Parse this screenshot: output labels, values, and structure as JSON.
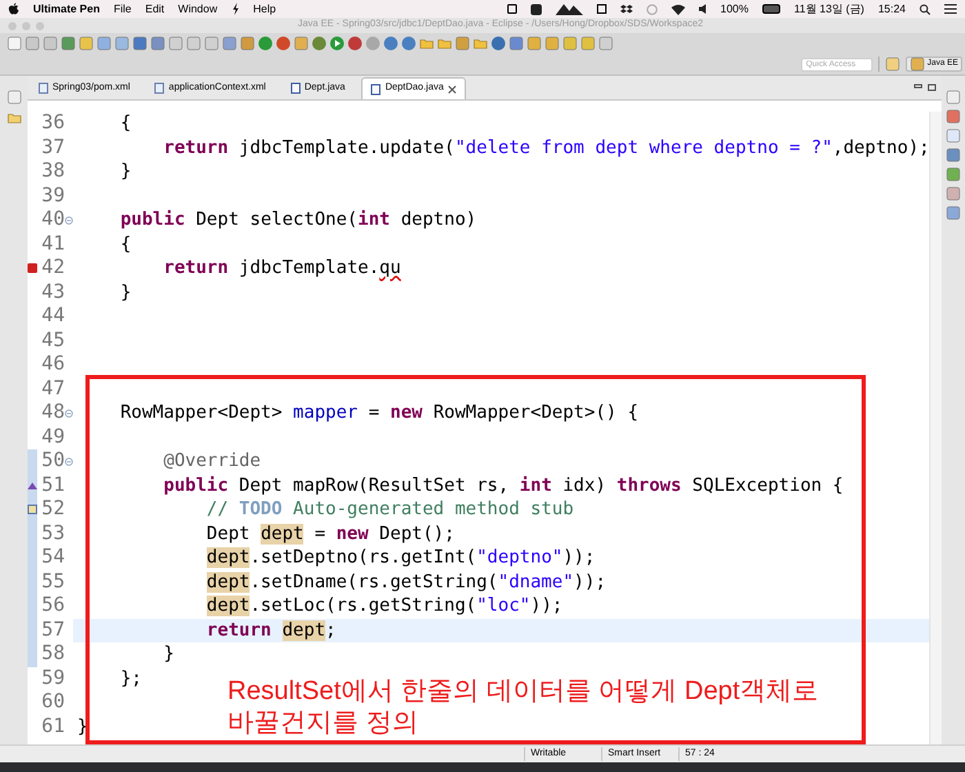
{
  "menu_bar": {
    "app_name": "Ultimate Pen",
    "items": [
      "File",
      "Edit",
      "Window",
      "Help"
    ],
    "battery": "100%",
    "date": "11월 13일 (금)",
    "time": "15:24"
  },
  "window": {
    "title": "Java EE - Spring03/src/jdbc1/DeptDao.java - Eclipse - /Users/Hong/Dropbox/SDS/Workspace2"
  },
  "toolbar": {
    "quick_access": {
      "placeholder": "Quick Access"
    },
    "perspective": "Java EE"
  },
  "tabs": [
    {
      "label": "Spring03/pom.xml",
      "kind": "xml",
      "selected": false
    },
    {
      "label": "applicationContext.xml",
      "kind": "xml",
      "selected": false
    },
    {
      "label": "Dept.java",
      "kind": "java",
      "selected": false
    },
    {
      "label": "DeptDao.java",
      "kind": "java",
      "selected": true
    }
  ],
  "editor": {
    "lines": [
      {
        "number": "36",
        "kind": "plain",
        "current": false,
        "range": false,
        "tokens": [
          {
            "kind": "plain",
            "text": "    {"
          }
        ]
      },
      {
        "number": "37",
        "kind": "plain",
        "current": false,
        "range": false,
        "tokens": [
          {
            "kind": "keyword",
            "text": "        return"
          },
          {
            "kind": "plain",
            "text": " jdbcTemplate.update("
          },
          {
            "kind": "string",
            "text": "\"delete from dept where deptno = ?\""
          },
          {
            "kind": "plain",
            "text": ",deptno);"
          }
        ]
      },
      {
        "number": "38",
        "kind": "plain",
        "current": false,
        "range": false,
        "tokens": [
          {
            "kind": "plain",
            "text": "    }"
          }
        ]
      },
      {
        "number": "39",
        "kind": "plain",
        "current": false,
        "range": false
      },
      {
        "number": "40",
        "kind": "fold",
        "current": false,
        "range": false,
        "tokens": [
          {
            "kind": "keyword",
            "text": "    public"
          },
          {
            "kind": "plain",
            "text": " Dept selectOne("
          },
          {
            "kind": "keyword",
            "text": "int"
          },
          {
            "kind": "plain",
            "text": " deptno)"
          }
        ]
      },
      {
        "number": "41",
        "kind": "plain",
        "current": false,
        "range": false,
        "tokens": [
          {
            "kind": "plain",
            "text": "    {"
          }
        ]
      },
      {
        "number": "42",
        "kind": "error",
        "current": false,
        "range": false,
        "tokens": [
          {
            "kind": "keyword",
            "text": "        return"
          },
          {
            "kind": "plain",
            "text": " jdbcTemplate."
          },
          {
            "kind": "error",
            "text": "qu"
          }
        ]
      },
      {
        "number": "43",
        "kind": "plain",
        "current": false,
        "range": false,
        "tokens": [
          {
            "kind": "plain",
            "text": "    }"
          }
        ]
      },
      {
        "number": "44",
        "kind": "plain",
        "current": false,
        "range": false
      },
      {
        "number": "45",
        "kind": "plain",
        "current": false,
        "range": false
      },
      {
        "number": "46",
        "kind": "plain",
        "current": false,
        "range": false
      },
      {
        "number": "47",
        "kind": "plain",
        "current": false,
        "range": false
      },
      {
        "number": "48",
        "kind": "fold",
        "current": false,
        "range": false,
        "tokens": [
          {
            "kind": "plain",
            "text": "    RowMapper<Dept> "
          },
          {
            "kind": "field",
            "text": "mapper"
          },
          {
            "kind": "plain",
            "text": " = "
          },
          {
            "kind": "keyword",
            "text": "new"
          },
          {
            "kind": "plain",
            "text": " RowMapper<Dept>() {"
          }
        ]
      },
      {
        "number": "49",
        "kind": "plain",
        "current": false,
        "range": false
      },
      {
        "number": "50",
        "kind": "fold",
        "current": false,
        "range": true,
        "tokens": [
          {
            "kind": "annotation",
            "text": "        @Override"
          }
        ]
      },
      {
        "number": "51",
        "kind": "override",
        "current": false,
        "range": true,
        "tokens": [
          {
            "kind": "keyword",
            "text": "        public"
          },
          {
            "kind": "plain",
            "text": " Dept mapRow(ResultSet rs, "
          },
          {
            "kind": "keyword",
            "text": "int"
          },
          {
            "kind": "plain",
            "text": " idx) "
          },
          {
            "kind": "keyword",
            "text": "throws"
          },
          {
            "kind": "plain",
            "text": " SQLException {"
          }
        ]
      },
      {
        "number": "52",
        "kind": "task",
        "current": false,
        "range": true,
        "tokens": [
          {
            "kind": "comment",
            "text": "            // "
          },
          {
            "kind": "todo",
            "text": "TODO"
          },
          {
            "kind": "comment",
            "text": " Auto-generated method stub"
          }
        ]
      },
      {
        "number": "53",
        "kind": "plain",
        "current": false,
        "range": true,
        "tokens": [
          {
            "kind": "plain",
            "text": "            Dept "
          },
          {
            "kind": "occurrence",
            "text": "dept"
          },
          {
            "kind": "plain",
            "text": " = "
          },
          {
            "kind": "keyword",
            "text": "new"
          },
          {
            "kind": "plain",
            "text": " Dept();"
          }
        ]
      },
      {
        "number": "54",
        "kind": "plain",
        "current": false,
        "range": true,
        "tokens": [
          {
            "kind": "occurrence",
            "text": "            dept"
          },
          {
            "kind": "plain",
            "text": ".setDeptno(rs.getInt("
          },
          {
            "kind": "string",
            "text": "\"deptno\""
          },
          {
            "kind": "plain",
            "text": "));"
          }
        ]
      },
      {
        "number": "55",
        "kind": "plain",
        "current": false,
        "range": true,
        "tokens": [
          {
            "kind": "occurrence",
            "text": "            dept"
          },
          {
            "kind": "plain",
            "text": ".setDname(rs.getString("
          },
          {
            "kind": "string",
            "text": "\"dname\""
          },
          {
            "kind": "plain",
            "text": "));"
          }
        ]
      },
      {
        "number": "56",
        "kind": "plain",
        "current": false,
        "range": true,
        "tokens": [
          {
            "kind": "occurrence",
            "text": "            dept"
          },
          {
            "kind": "plain",
            "text": ".setLoc(rs.getString("
          },
          {
            "kind": "string",
            "text": "\"loc\""
          },
          {
            "kind": "plain",
            "text": "));"
          }
        ]
      },
      {
        "number": "57",
        "kind": "plain",
        "current": true,
        "range": true,
        "tokens": [
          {
            "kind": "keyword",
            "text": "            return"
          },
          {
            "kind": "occurrence",
            "text": " dept"
          },
          {
            "kind": "plain",
            "text": ";"
          }
        ]
      },
      {
        "number": "58",
        "kind": "plain",
        "current": false,
        "range": true,
        "tokens": [
          {
            "kind": "plain",
            "text": "        }"
          }
        ]
      },
      {
        "number": "59",
        "kind": "plain",
        "current": false,
        "range": false,
        "tokens": [
          {
            "kind": "plain",
            "text": "    };"
          }
        ]
      },
      {
        "number": "60",
        "kind": "plain",
        "current": false,
        "range": false
      },
      {
        "number": "61",
        "kind": "plain",
        "current": false,
        "range": false,
        "tokens": [
          {
            "kind": "plain",
            "text": "}"
          }
        ]
      }
    ]
  },
  "annotation": {
    "lines": [
      "ResultSet에서 한줄의 데이터를 어떻게 Dept객체로",
      "바꿀건지를 정의"
    ]
  },
  "status_bar": [
    "Writable",
    "Smart Insert",
    "57 : 24"
  ]
}
